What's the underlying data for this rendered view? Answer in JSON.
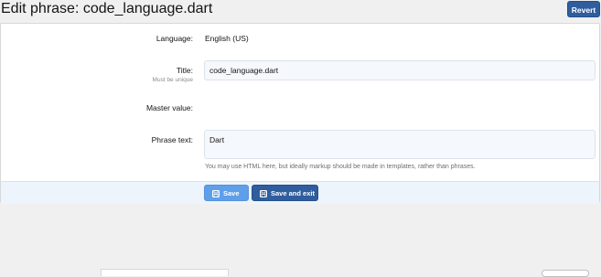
{
  "header": {
    "title": "Edit phrase: code_language.dart",
    "revert_label": "Revert"
  },
  "form": {
    "language": {
      "label": "Language:",
      "value": "English (US)"
    },
    "title": {
      "label": "Title:",
      "hint": "Must be unique",
      "value": "code_language.dart"
    },
    "master_value": {
      "label": "Master value:",
      "value": ""
    },
    "phrase_text": {
      "label": "Phrase text:",
      "value": "Dart",
      "explain": "You may use HTML here, but ideally markup should be made in templates, rather than phrases."
    }
  },
  "actions": {
    "save_label": "Save",
    "save_exit_label": "Save and exit",
    "icon": "save-icon"
  },
  "colors": {
    "primary": "#2f5d9e",
    "primary_light": "#5f9ee8",
    "submit_row_bg": "#edf4fc"
  }
}
